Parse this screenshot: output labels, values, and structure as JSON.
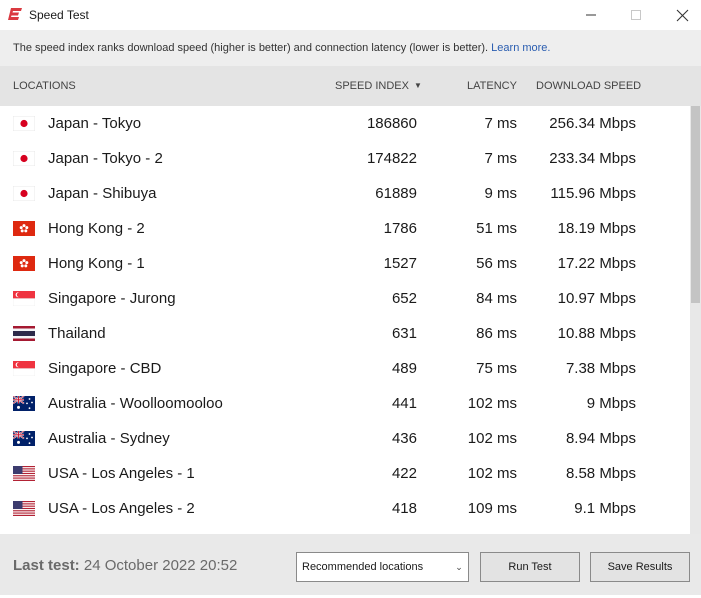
{
  "window": {
    "title": "Speed Test",
    "logo_icon": "expressvpn-logo-icon",
    "brand_color": "#da3940"
  },
  "info": {
    "text": "The speed index ranks download speed (higher is better) and connection latency (lower is better).",
    "link": "Learn more."
  },
  "columns": {
    "location": "LOCATIONS",
    "speed_index": "SPEED INDEX",
    "latency": "LATENCY",
    "download": "DOWNLOAD SPEED",
    "sort_icon": "sort-down-icon"
  },
  "rows": [
    {
      "flag": "jp",
      "location": "Japan - Tokyo",
      "speed_index": "186860",
      "latency": "7 ms",
      "download": "256.34 Mbps"
    },
    {
      "flag": "jp",
      "location": "Japan - Tokyo - 2",
      "speed_index": "174822",
      "latency": "7 ms",
      "download": "233.34 Mbps"
    },
    {
      "flag": "jp",
      "location": "Japan - Shibuya",
      "speed_index": "61889",
      "latency": "9 ms",
      "download": "115.96 Mbps"
    },
    {
      "flag": "hk",
      "location": "Hong Kong - 2",
      "speed_index": "1786",
      "latency": "51 ms",
      "download": "18.19 Mbps"
    },
    {
      "flag": "hk",
      "location": "Hong Kong - 1",
      "speed_index": "1527",
      "latency": "56 ms",
      "download": "17.22 Mbps"
    },
    {
      "flag": "sg",
      "location": "Singapore - Jurong",
      "speed_index": "652",
      "latency": "84 ms",
      "download": "10.97 Mbps"
    },
    {
      "flag": "th",
      "location": "Thailand",
      "speed_index": "631",
      "latency": "86 ms",
      "download": "10.88 Mbps"
    },
    {
      "flag": "sg",
      "location": "Singapore - CBD",
      "speed_index": "489",
      "latency": "75 ms",
      "download": "7.38 Mbps"
    },
    {
      "flag": "au",
      "location": "Australia - Woolloomooloo",
      "speed_index": "441",
      "latency": "102 ms",
      "download": "9 Mbps"
    },
    {
      "flag": "au",
      "location": "Australia - Sydney",
      "speed_index": "436",
      "latency": "102 ms",
      "download": "8.94 Mbps"
    },
    {
      "flag": "us",
      "location": "USA - Los Angeles - 1",
      "speed_index": "422",
      "latency": "102 ms",
      "download": "8.58 Mbps"
    },
    {
      "flag": "us",
      "location": "USA - Los Angeles - 2",
      "speed_index": "418",
      "latency": "109 ms",
      "download": "9.1 Mbps"
    }
  ],
  "footer": {
    "last_test_label": "Last test:",
    "last_test_value": "24 October 2022 20:52",
    "location_filter": "Recommended locations",
    "run_button": "Run Test",
    "save_button": "Save Results"
  }
}
